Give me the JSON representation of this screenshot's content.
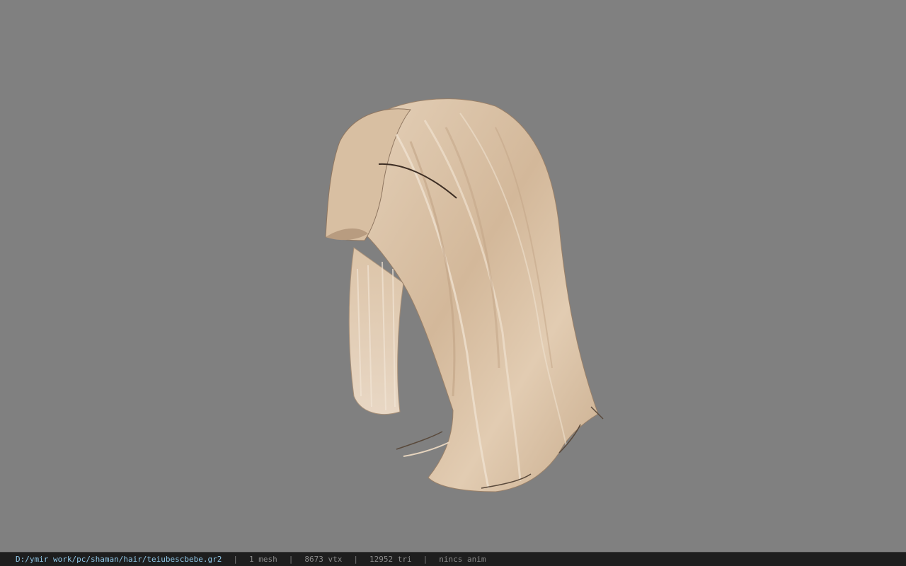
{
  "viewport": {
    "background_color": "#808080",
    "model_name": "hair-model-3d",
    "hair_base_color": "#d9c2a6",
    "hair_shadow_color": "#b59c80"
  },
  "status_bar": {
    "file_path": "D:/ymir work/pc/shaman/hair/teiubescbebe.gr2",
    "separator": "|",
    "mesh_count": "1 mesh",
    "vertex_count": "8673 vtx",
    "triangle_count": "12952 tri",
    "animation": "nincs anim",
    "path_color": "#8fc6e6"
  }
}
